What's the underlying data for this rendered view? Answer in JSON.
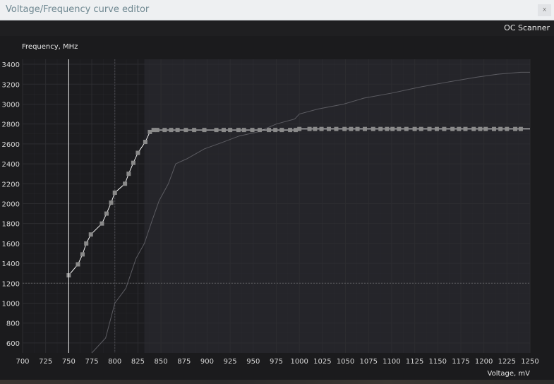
{
  "window": {
    "title": "Voltage/Frequency curve editor",
    "close_glyph": "x"
  },
  "toolbar": {
    "oc_scanner_label": "OC Scanner"
  },
  "chart_data": {
    "type": "line",
    "ylabel": "Frequency, MHz",
    "xlabel": "Voltage, mV",
    "xlim": [
      700,
      1250
    ],
    "ylim": [
      500,
      3450
    ],
    "x_ticks": [
      700,
      725,
      750,
      775,
      800,
      825,
      850,
      875,
      900,
      925,
      950,
      975,
      1000,
      1025,
      1050,
      1075,
      1100,
      1125,
      1150,
      1175,
      1200,
      1225,
      1250
    ],
    "y_ticks": [
      600,
      800,
      1000,
      1200,
      1400,
      1600,
      1800,
      2000,
      2200,
      2400,
      2600,
      2800,
      3000,
      3200,
      3400
    ],
    "grid": true,
    "selected_voltage": 750,
    "locked_frequency": 1200,
    "highlight_from_voltage": 832,
    "colors": {
      "plot_bg": "#1c1c1f",
      "highlight_bg": "#25252a",
      "grid": "#2c2c30",
      "curve": "#f2f2f2",
      "point": "#8a8a8a",
      "reference": "#5c5c62",
      "crosshair": "#f0f0f0"
    },
    "series": [
      {
        "role": "edited-curve",
        "x": [
          750,
          760,
          765,
          769,
          774,
          786,
          791,
          796,
          800,
          811,
          815,
          820,
          825,
          833,
          838,
          842,
          846,
          854,
          861,
          868,
          877,
          886,
          897,
          910,
          918,
          925,
          934,
          940,
          949,
          957,
          967,
          974,
          981,
          990,
          996,
          1000,
          1011,
          1017,
          1024,
          1032,
          1040,
          1049,
          1056,
          1063,
          1071,
          1080,
          1088,
          1095,
          1101,
          1108,
          1116,
          1125,
          1132,
          1141,
          1149,
          1157,
          1166,
          1173,
          1180,
          1189,
          1196,
          1202,
          1211,
          1218,
          1225,
          1234,
          1240
        ],
        "y": [
          1280,
          1390,
          1490,
          1600,
          1690,
          1800,
          1900,
          2010,
          2110,
          2200,
          2300,
          2410,
          2510,
          2620,
          2720,
          2740,
          2740,
          2740,
          2740,
          2740,
          2740,
          2740,
          2740,
          2740,
          2740,
          2740,
          2740,
          2740,
          2740,
          2740,
          2740,
          2740,
          2740,
          2740,
          2740,
          2750,
          2750,
          2750,
          2750,
          2750,
          2750,
          2750,
          2750,
          2750,
          2750,
          2750,
          2750,
          2750,
          2750,
          2750,
          2750,
          2750,
          2750,
          2750,
          2750,
          2750,
          2750,
          2750,
          2750,
          2750,
          2750,
          2750,
          2750,
          2750,
          2750,
          2750,
          2750
        ]
      },
      {
        "role": "reference-curve",
        "x": [
          775,
          790,
          800,
          812,
          823,
          832,
          840,
          848,
          858,
          866,
          878,
          897,
          915,
          935,
          955,
          975,
          995,
          1000,
          1020,
          1048,
          1070,
          1100,
          1130,
          1160,
          1192,
          1215,
          1240,
          1250
        ],
        "y": [
          500,
          650,
          1000,
          1150,
          1450,
          1600,
          1820,
          2030,
          2200,
          2400,
          2450,
          2550,
          2610,
          2680,
          2720,
          2800,
          2850,
          2900,
          2950,
          3000,
          3060,
          3110,
          3170,
          3220,
          3270,
          3300,
          3320,
          3320
        ]
      }
    ]
  }
}
